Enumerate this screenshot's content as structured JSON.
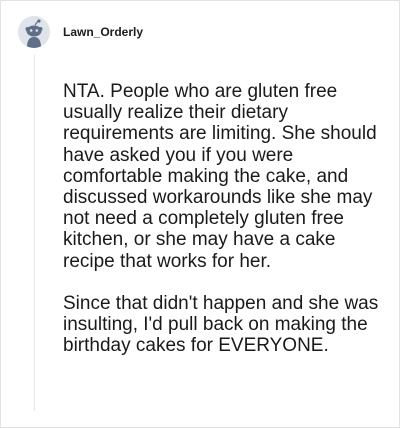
{
  "comment": {
    "username": "Lawn_Orderly",
    "paragraphs": [
      "NTA. People who are gluten free usually realize their dietary requirements are limiting. She should have asked you if you were comfortable making the cake, and discussed workarounds like she may not need a completely gluten free kitchen, or she may have a cake recipe that works for her.",
      "Since that didn't happen and she was insulting, I'd pull back on making the birthday cakes for EVERYONE."
    ]
  },
  "icons": {
    "avatar": "reddit-snoo-avatar-icon"
  },
  "colors": {
    "avatar_bg": "#dfe3ea",
    "snoo_body": "#5f6f8a",
    "text": "#1a1a1a"
  }
}
